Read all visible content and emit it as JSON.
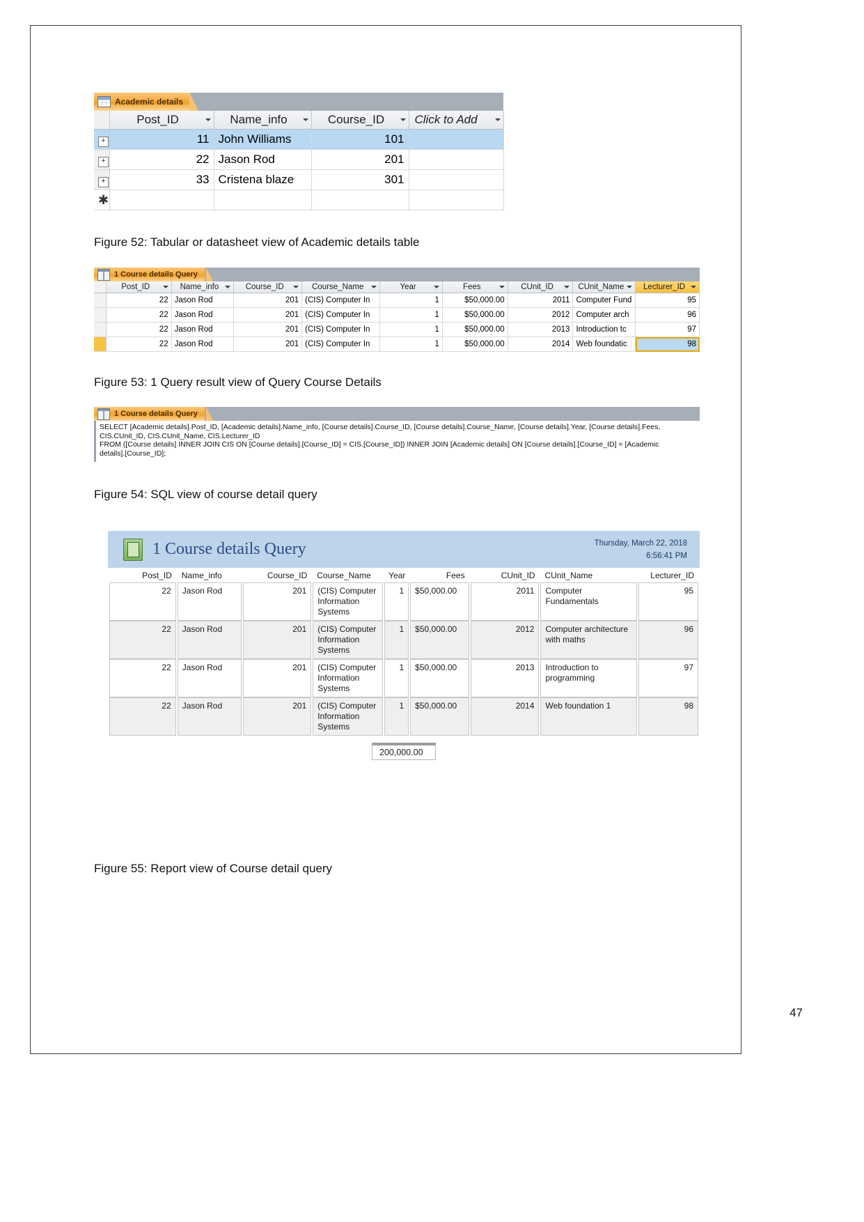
{
  "page": {
    "number": "47"
  },
  "figure52": {
    "caption": "Figure 52: Tabular or datasheet view of Academic details table",
    "tab_label": "Academic details",
    "tab_icon": "table-grid-icon",
    "columns": [
      "Post_ID",
      "Name_info",
      "Course_ID",
      "Click to Add"
    ],
    "rows": [
      {
        "expander": "+",
        "post_id": "11",
        "name_info": "John Williams",
        "course_id": "101",
        "selected": true
      },
      {
        "expander": "+",
        "post_id": "22",
        "name_info": "Jason Rod",
        "course_id": "201",
        "selected": false
      },
      {
        "expander": "+",
        "post_id": "33",
        "name_info": "Cristena blaze",
        "course_id": "301",
        "selected": false
      }
    ],
    "new_record_marker": "✱"
  },
  "figure53": {
    "caption": "Figure 53: 1 Query result view of Query Course Details",
    "tab_label": "1 Course details Query",
    "tab_icon": "query-icon",
    "columns": [
      "Post_ID",
      "Name_info",
      "Course_ID",
      "Course_Name",
      "Year",
      "Fees",
      "CUnit_ID",
      "CUnit_Name",
      "Lecturer_ID"
    ],
    "highlighted_column": "Lecturer_ID",
    "rows": [
      {
        "post_id": "22",
        "name_info": "Jason Rod",
        "course_id": "201",
        "course_name": "(CIS) Computer In",
        "year": "1",
        "fees": "$50,000.00",
        "cunit_id": "2011",
        "cunit_name": "Computer Fund",
        "lecturer_id": "95",
        "selected": false
      },
      {
        "post_id": "22",
        "name_info": "Jason Rod",
        "course_id": "201",
        "course_name": "(CIS) Computer In",
        "year": "1",
        "fees": "$50,000.00",
        "cunit_id": "2012",
        "cunit_name": "Computer arch",
        "lecturer_id": "96",
        "selected": false
      },
      {
        "post_id": "22",
        "name_info": "Jason Rod",
        "course_id": "201",
        "course_name": "(CIS) Computer In",
        "year": "1",
        "fees": "$50,000.00",
        "cunit_id": "2013",
        "cunit_name": "Introduction tc",
        "lecturer_id": "97",
        "selected": false
      },
      {
        "post_id": "22",
        "name_info": "Jason Rod",
        "course_id": "201",
        "course_name": "(CIS) Computer In",
        "year": "1",
        "fees": "$50,000.00",
        "cunit_id": "2014",
        "cunit_name": "Web foundatic",
        "lecturer_id": "98",
        "selected": true
      }
    ]
  },
  "figure54": {
    "caption": "Figure 54: SQL view of course detail query",
    "tab_label": "1 Course details Query",
    "tab_icon": "query-icon",
    "sql": "SELECT [Academic details].Post_ID, [Academic details].Name_info, [Course details].Course_ID, [Course details].Course_Name, [Course details].Year, [Course details].Fees,\nCIS.CUnit_ID, CIS.CUnit_Name, CIS.Lecturer_ID\nFROM ([Course details] INNER JOIN CIS ON [Course details].[Course_ID] = CIS.[Course_ID]) INNER JOIN [Academic details] ON [Course details].[Course_ID] = [Academic\ndetails].[Course_ID];"
  },
  "figure55": {
    "caption": "Figure 55: Report view of Course detail query",
    "title": "1 Course details Query",
    "report_icon": "report-book-icon",
    "date": "Thursday, March 22, 2018",
    "time": "6:56:41 PM",
    "columns": [
      "Post_ID",
      "Name_info",
      "Course_ID",
      "Course_Name",
      "Year",
      "Fees",
      "CUnit_ID",
      "CUnit_Name",
      "Lecturer_ID"
    ],
    "rows": [
      {
        "post_id": "22",
        "name_info": "Jason Rod",
        "course_id": "201",
        "course_name": "(CIS) Computer Information Systems",
        "year": "1",
        "fees": "$50,000.00",
        "cunit_id": "2011",
        "cunit_name": "Computer Fundamentals",
        "lecturer_id": "95"
      },
      {
        "post_id": "22",
        "name_info": "Jason Rod",
        "course_id": "201",
        "course_name": "(CIS) Computer Information Systems",
        "year": "1",
        "fees": "$50,000.00",
        "cunit_id": "2012",
        "cunit_name": "Computer architecture with maths",
        "lecturer_id": "96"
      },
      {
        "post_id": "22",
        "name_info": "Jason Rod",
        "course_id": "201",
        "course_name": "(CIS) Computer Information Systems",
        "year": "1",
        "fees": "$50,000.00",
        "cunit_id": "2013",
        "cunit_name": "Introduction to programming",
        "lecturer_id": "97"
      },
      {
        "post_id": "22",
        "name_info": "Jason Rod",
        "course_id": "201",
        "course_name": "(CIS) Computer Information Systems",
        "year": "1",
        "fees": "$50,000.00",
        "cunit_id": "2014",
        "cunit_name": "Web foundation 1",
        "lecturer_id": "98"
      }
    ],
    "total": "200,000.00"
  },
  "colors": {
    "tab_orange": "#f5a93d",
    "tabbar_gray": "#a6aeb8",
    "selection_blue": "#b9d8f2",
    "report_header_blue": "#bdd4ea",
    "report_title_blue": "#2b4a86",
    "highlight_gold": "#f7c242"
  }
}
